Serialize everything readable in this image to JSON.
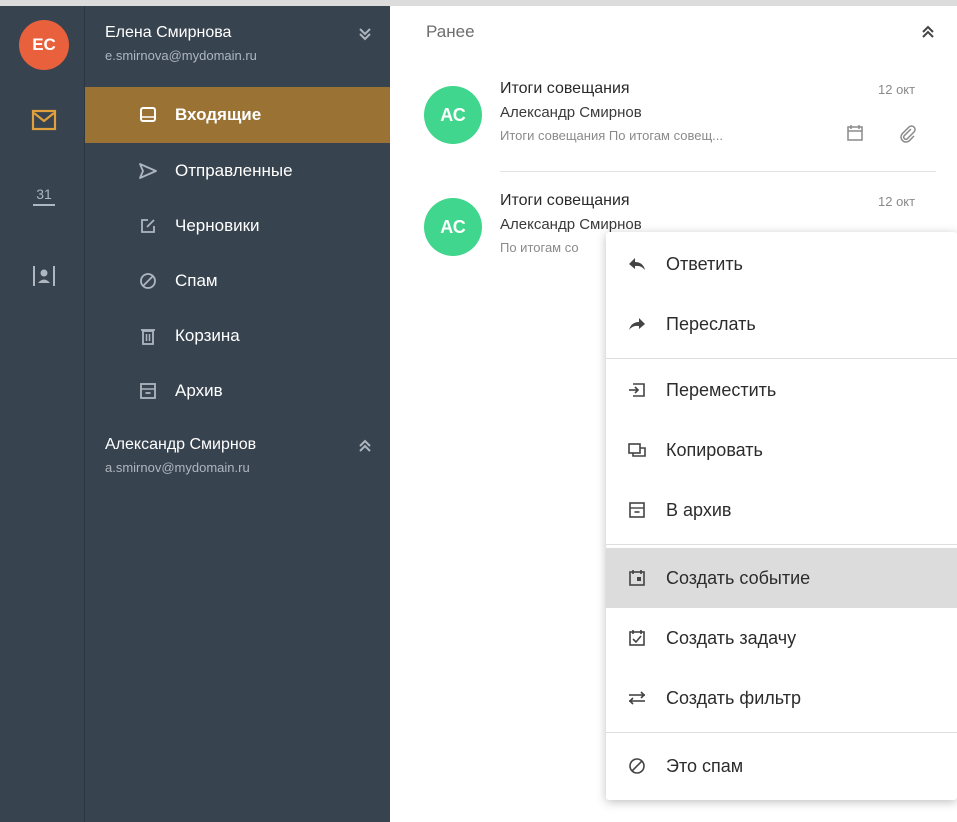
{
  "user": {
    "initials": "ЕС"
  },
  "accounts": [
    {
      "name": "Елена Смирнова",
      "email": "e.smirnova@mydomain.ru"
    },
    {
      "name": "Александр Смирнов",
      "email": "a.smirnov@mydomain.ru"
    }
  ],
  "rail": {
    "calendar_day": "31"
  },
  "folders": [
    {
      "label": "Входящие",
      "icon": "inbox-icon",
      "active": true
    },
    {
      "label": "Отправленные",
      "icon": "send-icon"
    },
    {
      "label": "Черновики",
      "icon": "draft-icon"
    },
    {
      "label": "Спам",
      "icon": "spam-icon"
    },
    {
      "label": "Корзина",
      "icon": "trash-icon"
    },
    {
      "label": "Архив",
      "icon": "archive-icon"
    }
  ],
  "main": {
    "section": "Ранее"
  },
  "messages": [
    {
      "initials": "АС",
      "subject": "Итоги совещания",
      "sender": "Александр Смирнов",
      "preview": "Итоги совещания По итогам совещ...",
      "date": "12 окт"
    },
    {
      "initials": "АС",
      "subject": "Итоги совещания",
      "sender": "Александр Смирнов",
      "preview": "По итогам со",
      "date": "12 окт"
    }
  ],
  "context_menu": {
    "items": [
      {
        "label": "Ответить",
        "icon": "reply-icon"
      },
      {
        "label": "Переслать",
        "icon": "forward-icon"
      },
      {
        "label": "Переместить",
        "icon": "move-icon"
      },
      {
        "label": "Копировать",
        "icon": "copy-icon"
      },
      {
        "label": "В архив",
        "icon": "archive-icon"
      },
      {
        "label": "Создать событие",
        "icon": "event-icon",
        "highlighted": true
      },
      {
        "label": "Создать задачу",
        "icon": "task-icon"
      },
      {
        "label": "Создать фильтр",
        "icon": "filter-icon"
      },
      {
        "label": "Это спам",
        "icon": "spam-icon"
      }
    ]
  },
  "colors": {
    "accent": "#9a7233",
    "sidebar": "#37434f",
    "user_avatar": "#e8603c",
    "contact_avatar": "#41d68d",
    "rail_icon": "#e0a03c"
  }
}
